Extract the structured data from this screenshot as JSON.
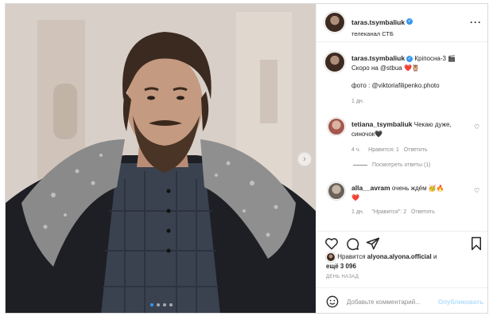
{
  "header": {
    "username": "taras.tsymbaliuk",
    "subtitle": "телеканал СТБ",
    "more": "···"
  },
  "caption": {
    "username": "taras.tsymbaliuk",
    "text_after_name": "Кріпосна-3 🎬",
    "line2": "Скоро на @stbua ❤️🦉",
    "line3": "фото : @viktoriafilipenko.photo",
    "time": "1 дн."
  },
  "comments": [
    {
      "username": "tetiana_tsymbaliuk",
      "text_after_name": "Чекаю дуже,",
      "text_line2": "синочок🖤",
      "time": "4 ч.",
      "likes": "Нравится: 1",
      "reply": "Ответить",
      "view_replies": "Посмотреть ответы (1)"
    },
    {
      "username": "alla__avram",
      "text_after_name": "очень ждём 🥳🔥",
      "text_line2": "❤️",
      "time": "1 дн.",
      "likes": "\"Нравится\": 2",
      "reply": "Ответить"
    }
  ],
  "likes": {
    "prefix": "Нравится",
    "user": "alyona.alyona.official",
    "middle": "и",
    "count": "ещё 3 096"
  },
  "date": "ДЕНЬ НАЗАД",
  "add_comment": {
    "placeholder": "Добавьте комментарий...",
    "post": "Опубликовать"
  },
  "icons": {
    "like": "heart-icon",
    "comment": "comment-icon",
    "share": "send-icon",
    "save": "bookmark-icon",
    "emoji": "emoji-icon",
    "next": "chevron-right-icon"
  },
  "colors": {
    "link": "#00376b",
    "verified": "#3897f0",
    "muted": "#8e8e8e",
    "post_disabled": "#b2dffc"
  }
}
